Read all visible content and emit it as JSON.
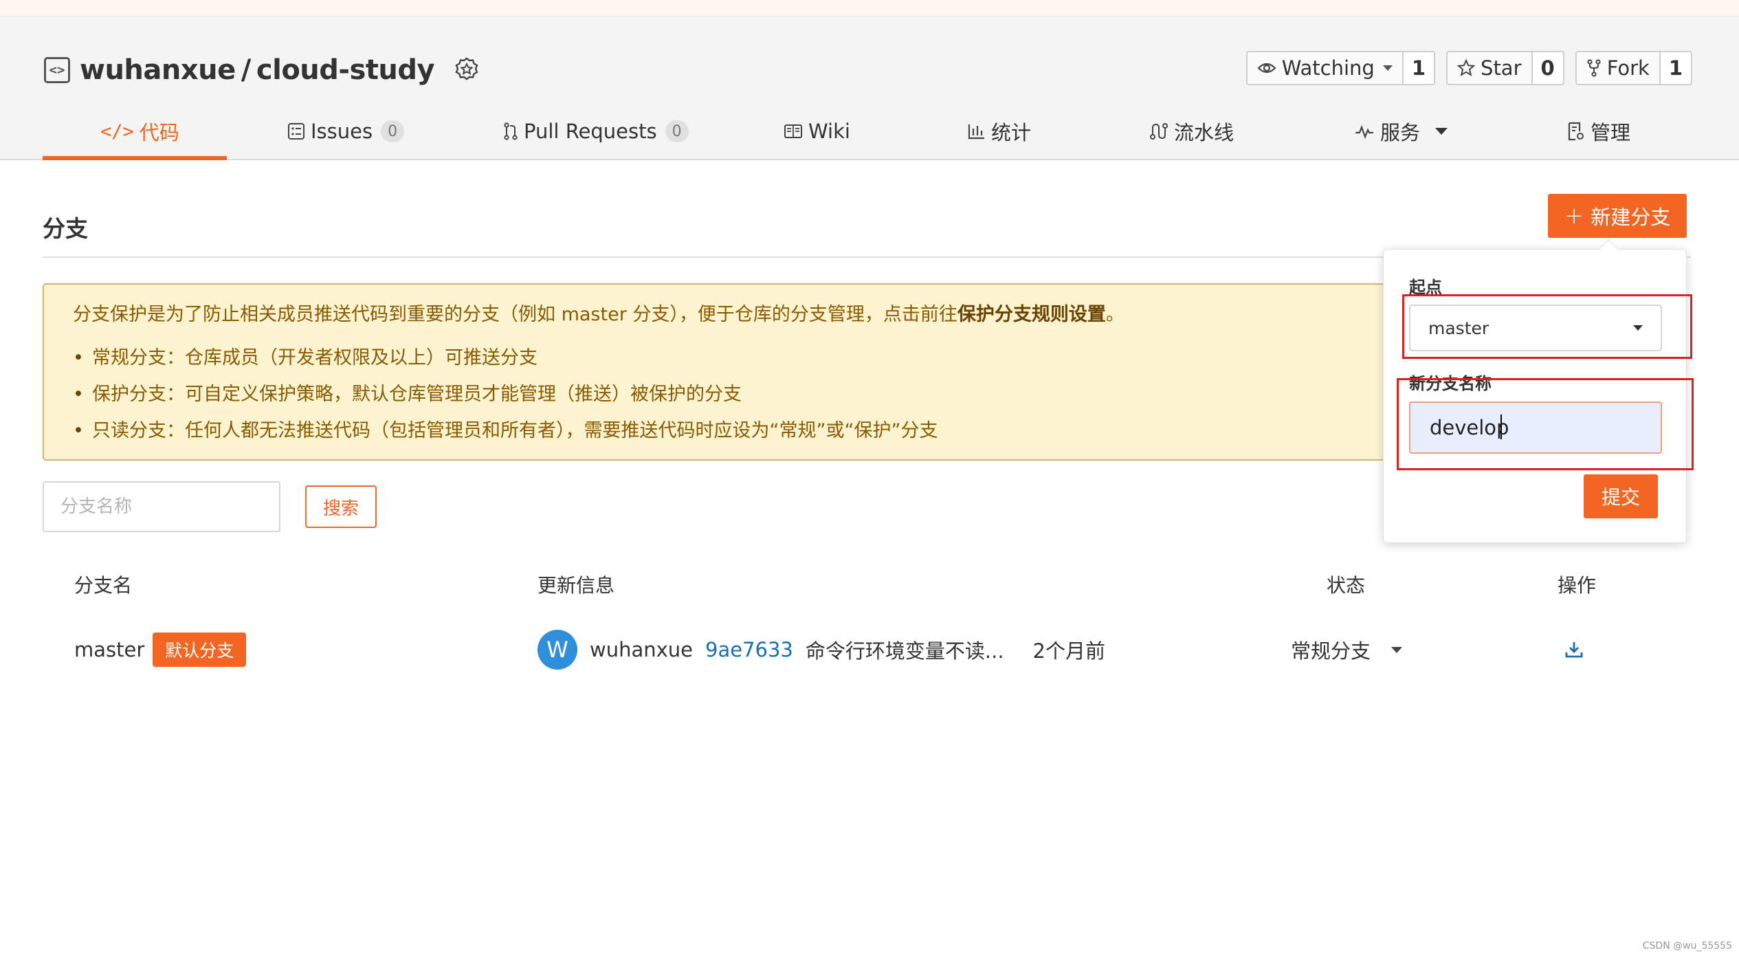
{
  "repo": {
    "owner": "wuhanxue",
    "separator": "/",
    "name": "cloud-study",
    "actions": [
      {
        "label": "Watching",
        "count": "1"
      },
      {
        "label": "Star",
        "count": "0"
      },
      {
        "label": "Fork",
        "count": "1"
      }
    ]
  },
  "tabs": [
    {
      "label": "代码",
      "icon": "code-icon",
      "active": true
    },
    {
      "label": "Issues",
      "count": "0",
      "icon": "issues-icon"
    },
    {
      "label": "Pull Requests",
      "count": "0",
      "icon": "pull-request-icon"
    },
    {
      "label": "Wiki",
      "icon": "book-icon"
    },
    {
      "label": "统计",
      "icon": "bar-chart-icon"
    },
    {
      "label": "流水线",
      "icon": "pipeline-icon"
    },
    {
      "label": "服务",
      "icon": "pulse-icon"
    },
    {
      "label": "管理",
      "icon": "settings-doc-icon"
    }
  ],
  "branches_page": {
    "title": "分支",
    "new_branch_label": "新建分支",
    "notice": {
      "intro": "分支保护是为了防止相关成员推送代码到重要的分支（例如 master 分支），便于仓库的分支管理，点击前往",
      "link": "保护分支规则设置",
      "end": "。",
      "items": [
        "常规分支：仓库成员（开发者权限及以上）可推送分支",
        "保护分支：可自定义保护策略，默认仓库管理员才能管理（推送）被保护的分支",
        "只读分支：任何人都无法推送代码（包括管理员和所有者），需要推送代码时应设为“常规”或“保护”分支"
      ]
    },
    "search": {
      "placeholder": "分支名称",
      "button": "搜索"
    },
    "table": {
      "headers": {
        "name": "分支名",
        "update": "更新信息",
        "status": "状态",
        "ops": "操作"
      },
      "rows": [
        {
          "branch": "master",
          "badge": "默认分支",
          "avatar_letter": "W",
          "author": "wuhanxue",
          "commit": "9ae7633",
          "message": "命令行环境变量不读...",
          "time": "2个月前",
          "status": "常规分支"
        }
      ]
    }
  },
  "popover": {
    "start_label": "起点",
    "start_value": "master",
    "name_label": "新分支名称",
    "name_value": "develop",
    "submit": "提交"
  },
  "watermark": "CSDN @wu_55555",
  "colors": {
    "accent": "#f26522",
    "notice_bg": "#fcf3d0",
    "highlight": "#e01e1e",
    "link": "#1a6fb0"
  }
}
